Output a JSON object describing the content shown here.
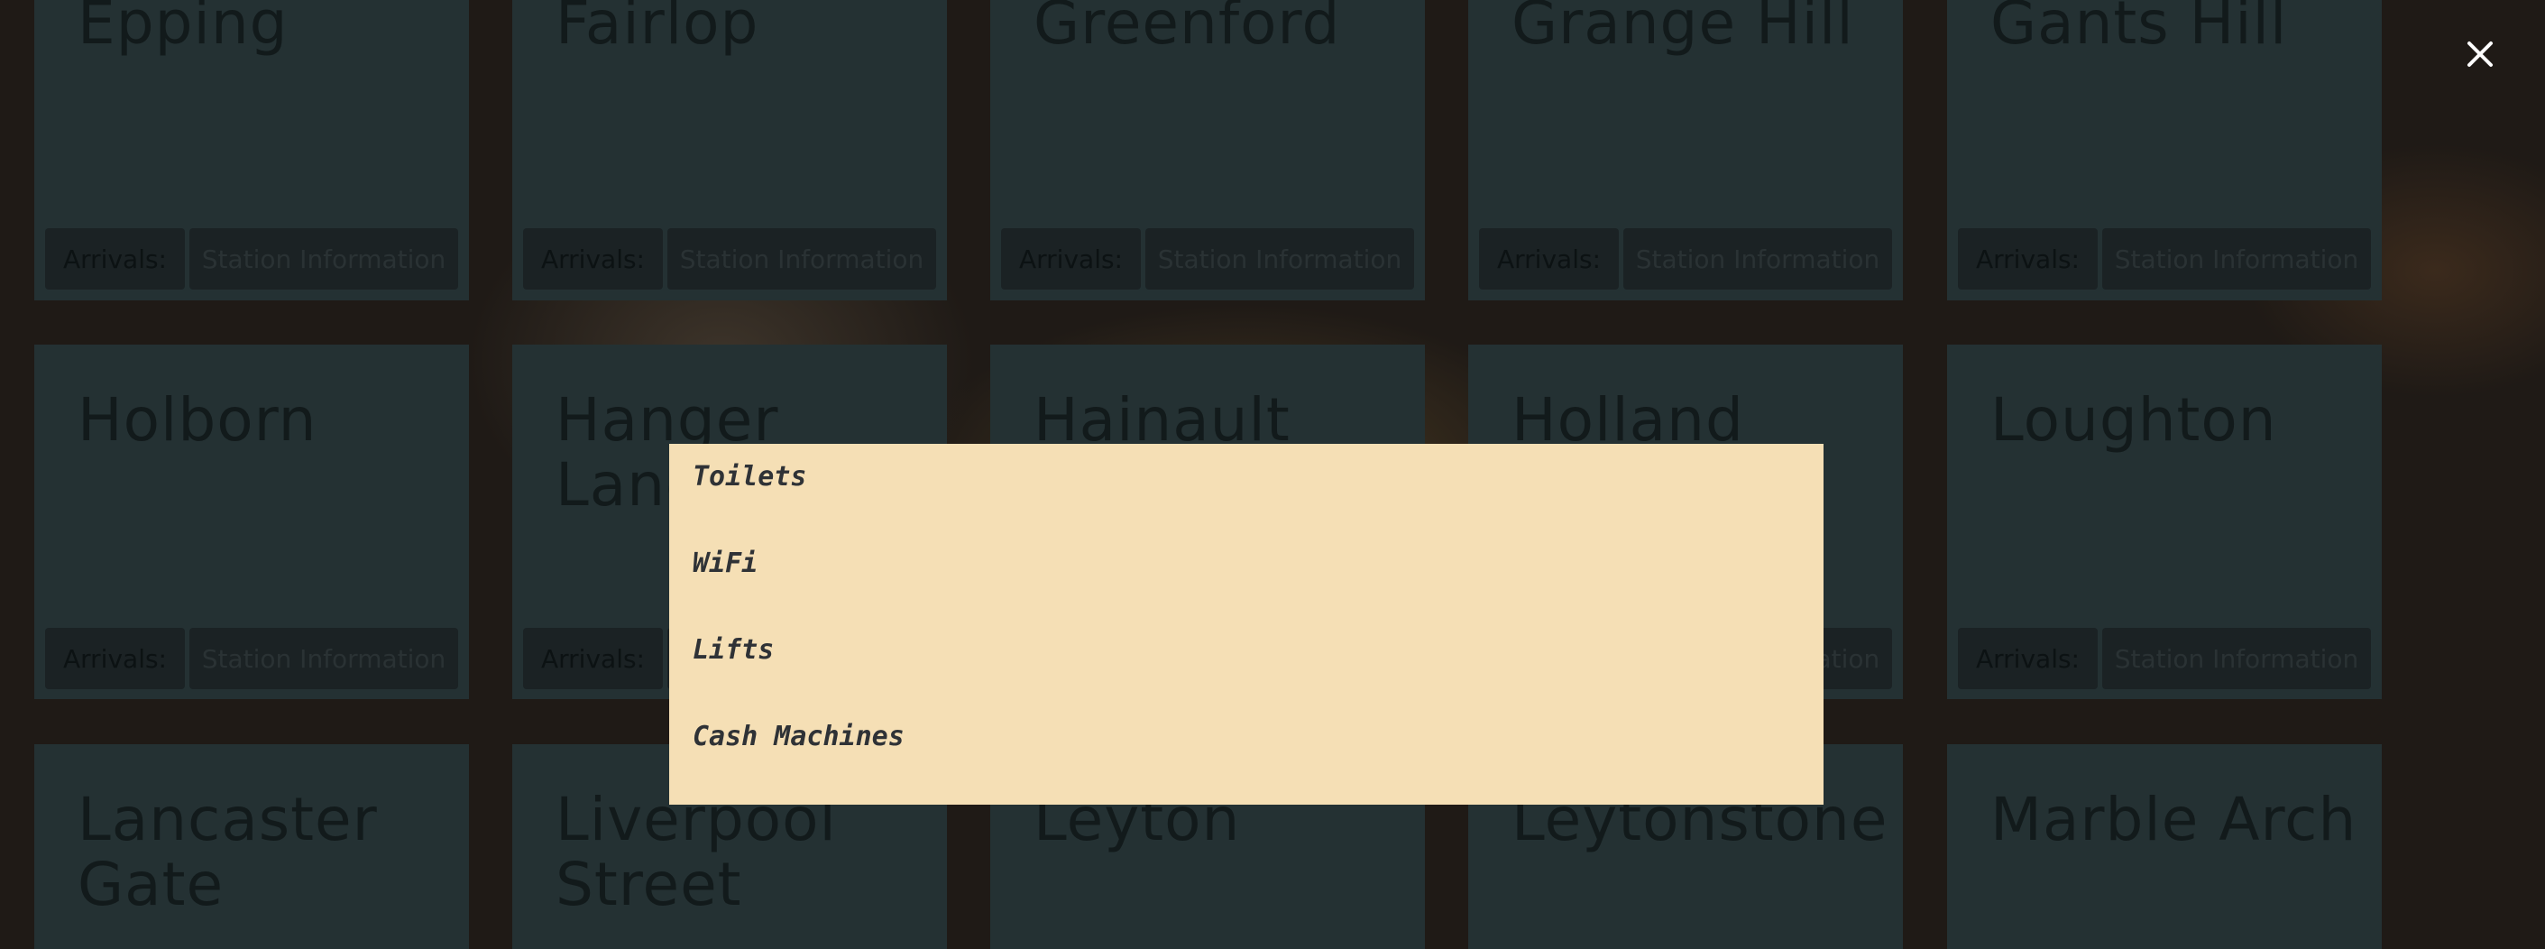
{
  "labels": {
    "arrivals": "Arrivals:",
    "station_info": "Station Information"
  },
  "stations": [
    {
      "name": "Epping"
    },
    {
      "name": "Fairlop"
    },
    {
      "name": "Greenford"
    },
    {
      "name": "Grange Hill"
    },
    {
      "name": "Gants Hill"
    },
    {
      "name": "Holborn"
    },
    {
      "name": "Hanger Lane"
    },
    {
      "name": "Hainault"
    },
    {
      "name": "Holland"
    },
    {
      "name": "Loughton"
    },
    {
      "name": "Lancaster Gate"
    },
    {
      "name": "Liverpool Street"
    },
    {
      "name": "Leyton"
    },
    {
      "name": "Leytonstone"
    },
    {
      "name": "Marble Arch"
    }
  ],
  "facilities": {
    "items": [
      "Toilets",
      "WiFi",
      "Lifts",
      "Cash Machines"
    ]
  },
  "icons": {
    "close": "close-icon"
  },
  "colors": {
    "overlay_bg": "#f5dfb5",
    "card_bg": "#243133",
    "close_icon": "#ffffff"
  }
}
